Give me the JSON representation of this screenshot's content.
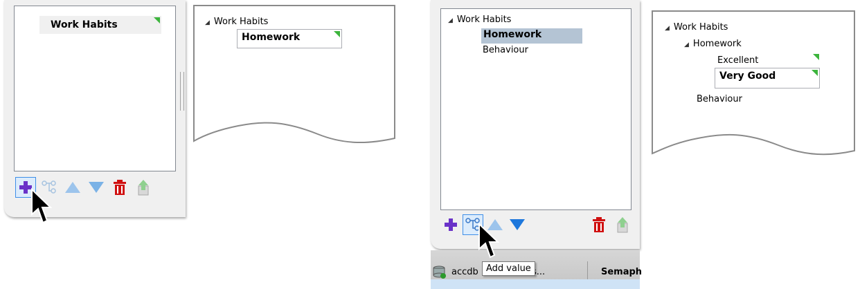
{
  "panel1": {
    "item_label": "Work Habits"
  },
  "panel2": {
    "root": "Work Habits",
    "editing_value": "Homework"
  },
  "panel3": {
    "root": "Work Habits",
    "selected_item": "Homework",
    "other_item": "Behaviour",
    "tooltip": "Add value",
    "taskbar_left": "accdb",
    "taskbar_mid": "s...",
    "taskbar_right": "Semaph"
  },
  "panel4": {
    "root": "Work Habits",
    "child": "Homework",
    "value1": "Excellent",
    "value2_editing": "Very Good",
    "other_item": "Behaviour"
  },
  "toolbar_icons": [
    "add-icon",
    "add-value-icon",
    "move-up-icon",
    "move-down-icon",
    "delete-icon",
    "export-icon"
  ],
  "colors": {
    "accent_green": "#3cb43c",
    "selection": "#b4c4d4",
    "add_purple": "#6a32c8",
    "delete_red": "#d01010",
    "arrow_blue": "#1e78dc"
  }
}
